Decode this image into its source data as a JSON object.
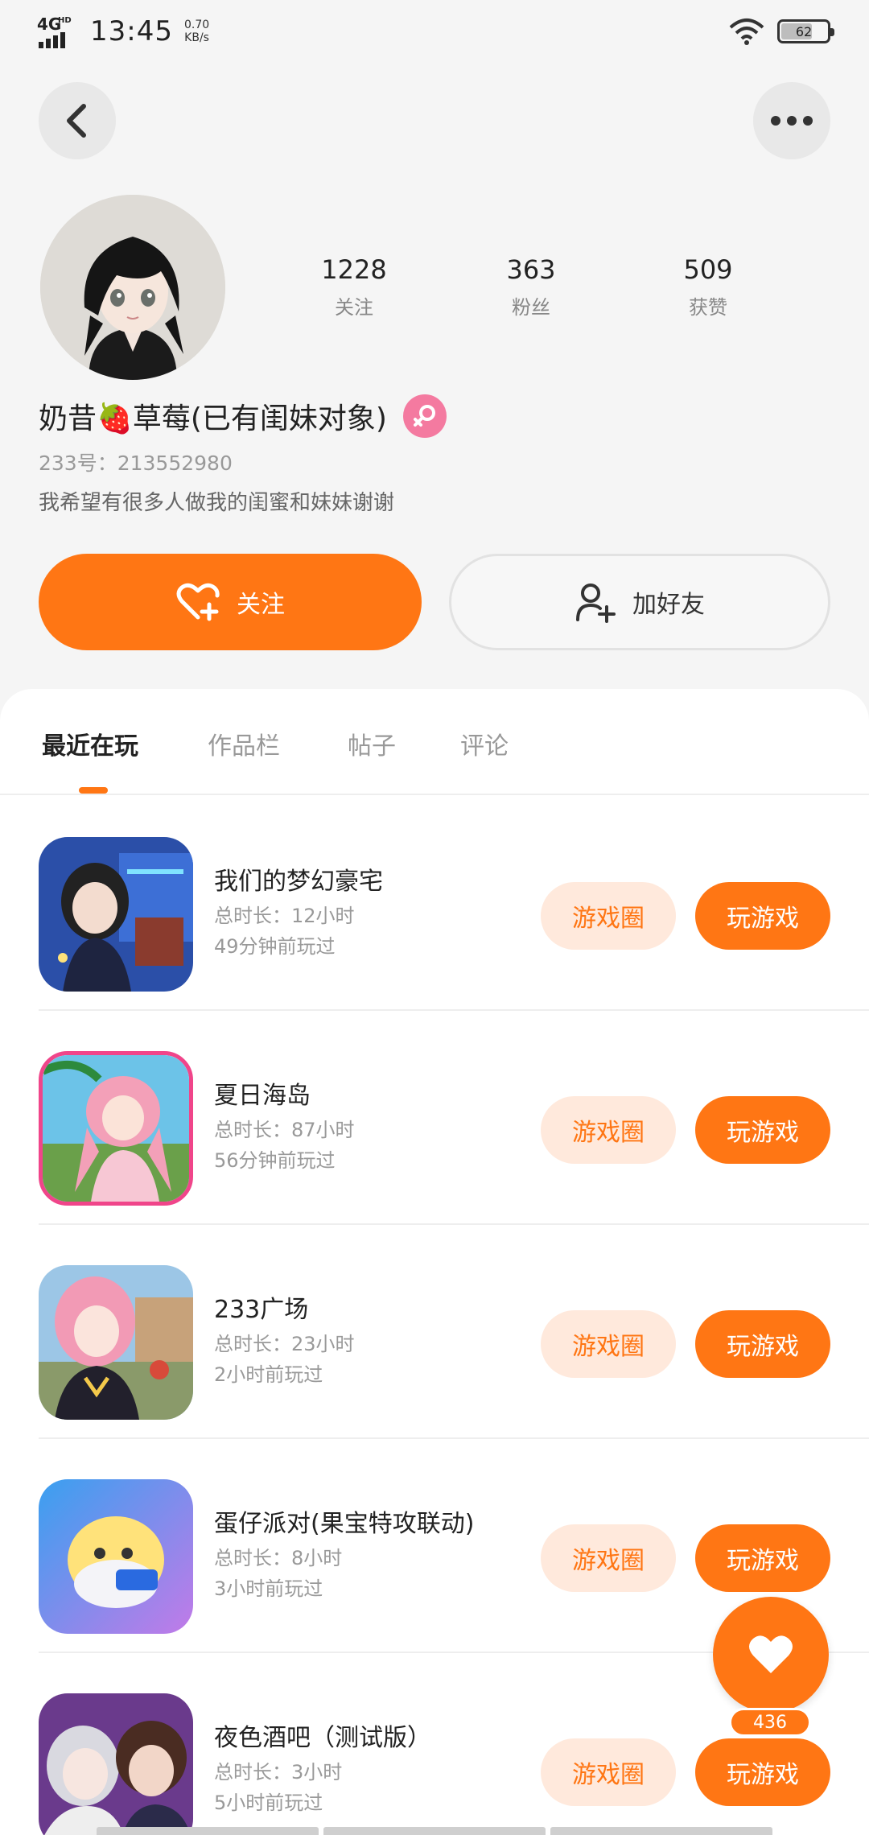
{
  "status_bar": {
    "network": "4G",
    "network_hd": "HD",
    "time": "13:45",
    "speed_value": "0.70",
    "speed_unit": "KB/s",
    "battery": "62"
  },
  "profile": {
    "stats": [
      {
        "value": "1228",
        "label": "关注"
      },
      {
        "value": "363",
        "label": "粉丝"
      },
      {
        "value": "509",
        "label": "获赞"
      }
    ],
    "name": "奶昔🍓草莓(已有闺妹对象)",
    "uid": "233号：213552980",
    "bio": "我希望有很多人做我的闺蜜和妹妹谢谢",
    "follow_label": "关注",
    "add_friend_label": "加好友"
  },
  "tabs": [
    "最近在玩",
    "作品栏",
    "帖子",
    "评论"
  ],
  "games": [
    {
      "title": "我们的梦幻豪宅",
      "duration": "总时长：12小时",
      "last_played": "49分钟前玩过",
      "circle_label": "游戏圈",
      "play_label": "玩游戏"
    },
    {
      "title": "夏日海岛",
      "duration": "总时长：87小时",
      "last_played": "56分钟前玩过",
      "circle_label": "游戏圈",
      "play_label": "玩游戏"
    },
    {
      "title": "233广场",
      "duration": "总时长：23小时",
      "last_played": "2小时前玩过",
      "circle_label": "游戏圈",
      "play_label": "玩游戏"
    },
    {
      "title": "蛋仔派对(果宝特攻联动)",
      "duration": "总时长：8小时",
      "last_played": "3小时前玩过",
      "circle_label": "游戏圈",
      "play_label": "玩游戏"
    },
    {
      "title": "夜色酒吧（测试版）",
      "duration": "总时长：3小时",
      "last_played": "5小时前玩过",
      "circle_label": "游戏圈",
      "play_label": "玩游戏"
    }
  ],
  "float_like_count": "436",
  "colors": {
    "accent": "#ff7614",
    "accent_light": "#ffe9dc",
    "gender_pink": "#f47aa0"
  },
  "icons": [
    "back-icon",
    "more-icon",
    "female-icon",
    "heart-plus-icon",
    "add-user-icon",
    "heart-icon",
    "wifi-icon",
    "battery-icon",
    "signal-icon"
  ]
}
